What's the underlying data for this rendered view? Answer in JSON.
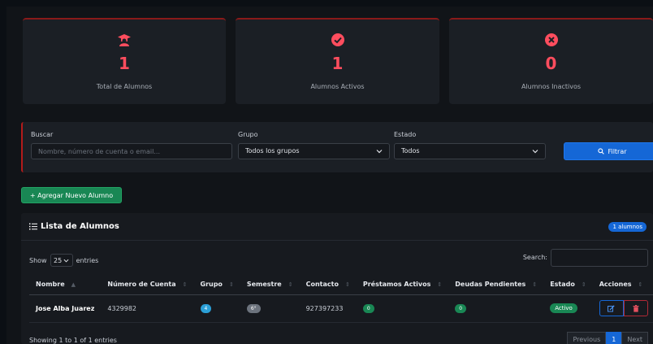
{
  "stats": [
    {
      "icon": "graduate-icon",
      "value": "1",
      "label": "Total de Alumnos"
    },
    {
      "icon": "check-circle-icon",
      "value": "1",
      "label": "Alumnos Activos"
    },
    {
      "icon": "x-circle-icon",
      "value": "0",
      "label": "Alumnos Inactivos"
    }
  ],
  "filters": {
    "search_label": "Buscar",
    "search_placeholder": "Nombre, número de cuenta o email...",
    "group_label": "Grupo",
    "group_value": "Todos los grupos",
    "state_label": "Estado",
    "state_value": "Todos",
    "filter_button": "Filtrar"
  },
  "add_button": "+ Agregar Nuevo Alumno",
  "list": {
    "title": "Lista de Alumnos",
    "count_badge": "1 alumnos",
    "show_label": "Show",
    "entries_value": "25",
    "entries_label": "entries",
    "search_label": "Search:",
    "columns": [
      "Nombre",
      "Número de Cuenta",
      "Grupo",
      "Semestre",
      "Contacto",
      "Préstamos Activos",
      "Deudas Pendientes",
      "Estado",
      "Acciones"
    ],
    "rows": [
      {
        "nombre": "Jose Alba Juarez",
        "cuenta": "4329982",
        "grupo": "4",
        "semestre": "6°",
        "contacto": "927397233",
        "prestamos": "0",
        "deudas": "0",
        "estado": "Activo"
      }
    ],
    "info": "Showing 1 to 1 of 1 entries",
    "pager": {
      "previous": "Previous",
      "current": "1",
      "next": "Next"
    }
  },
  "colors": {
    "accent_red": "#ff4d5e",
    "primary": "#1567d6",
    "success": "#198754"
  }
}
